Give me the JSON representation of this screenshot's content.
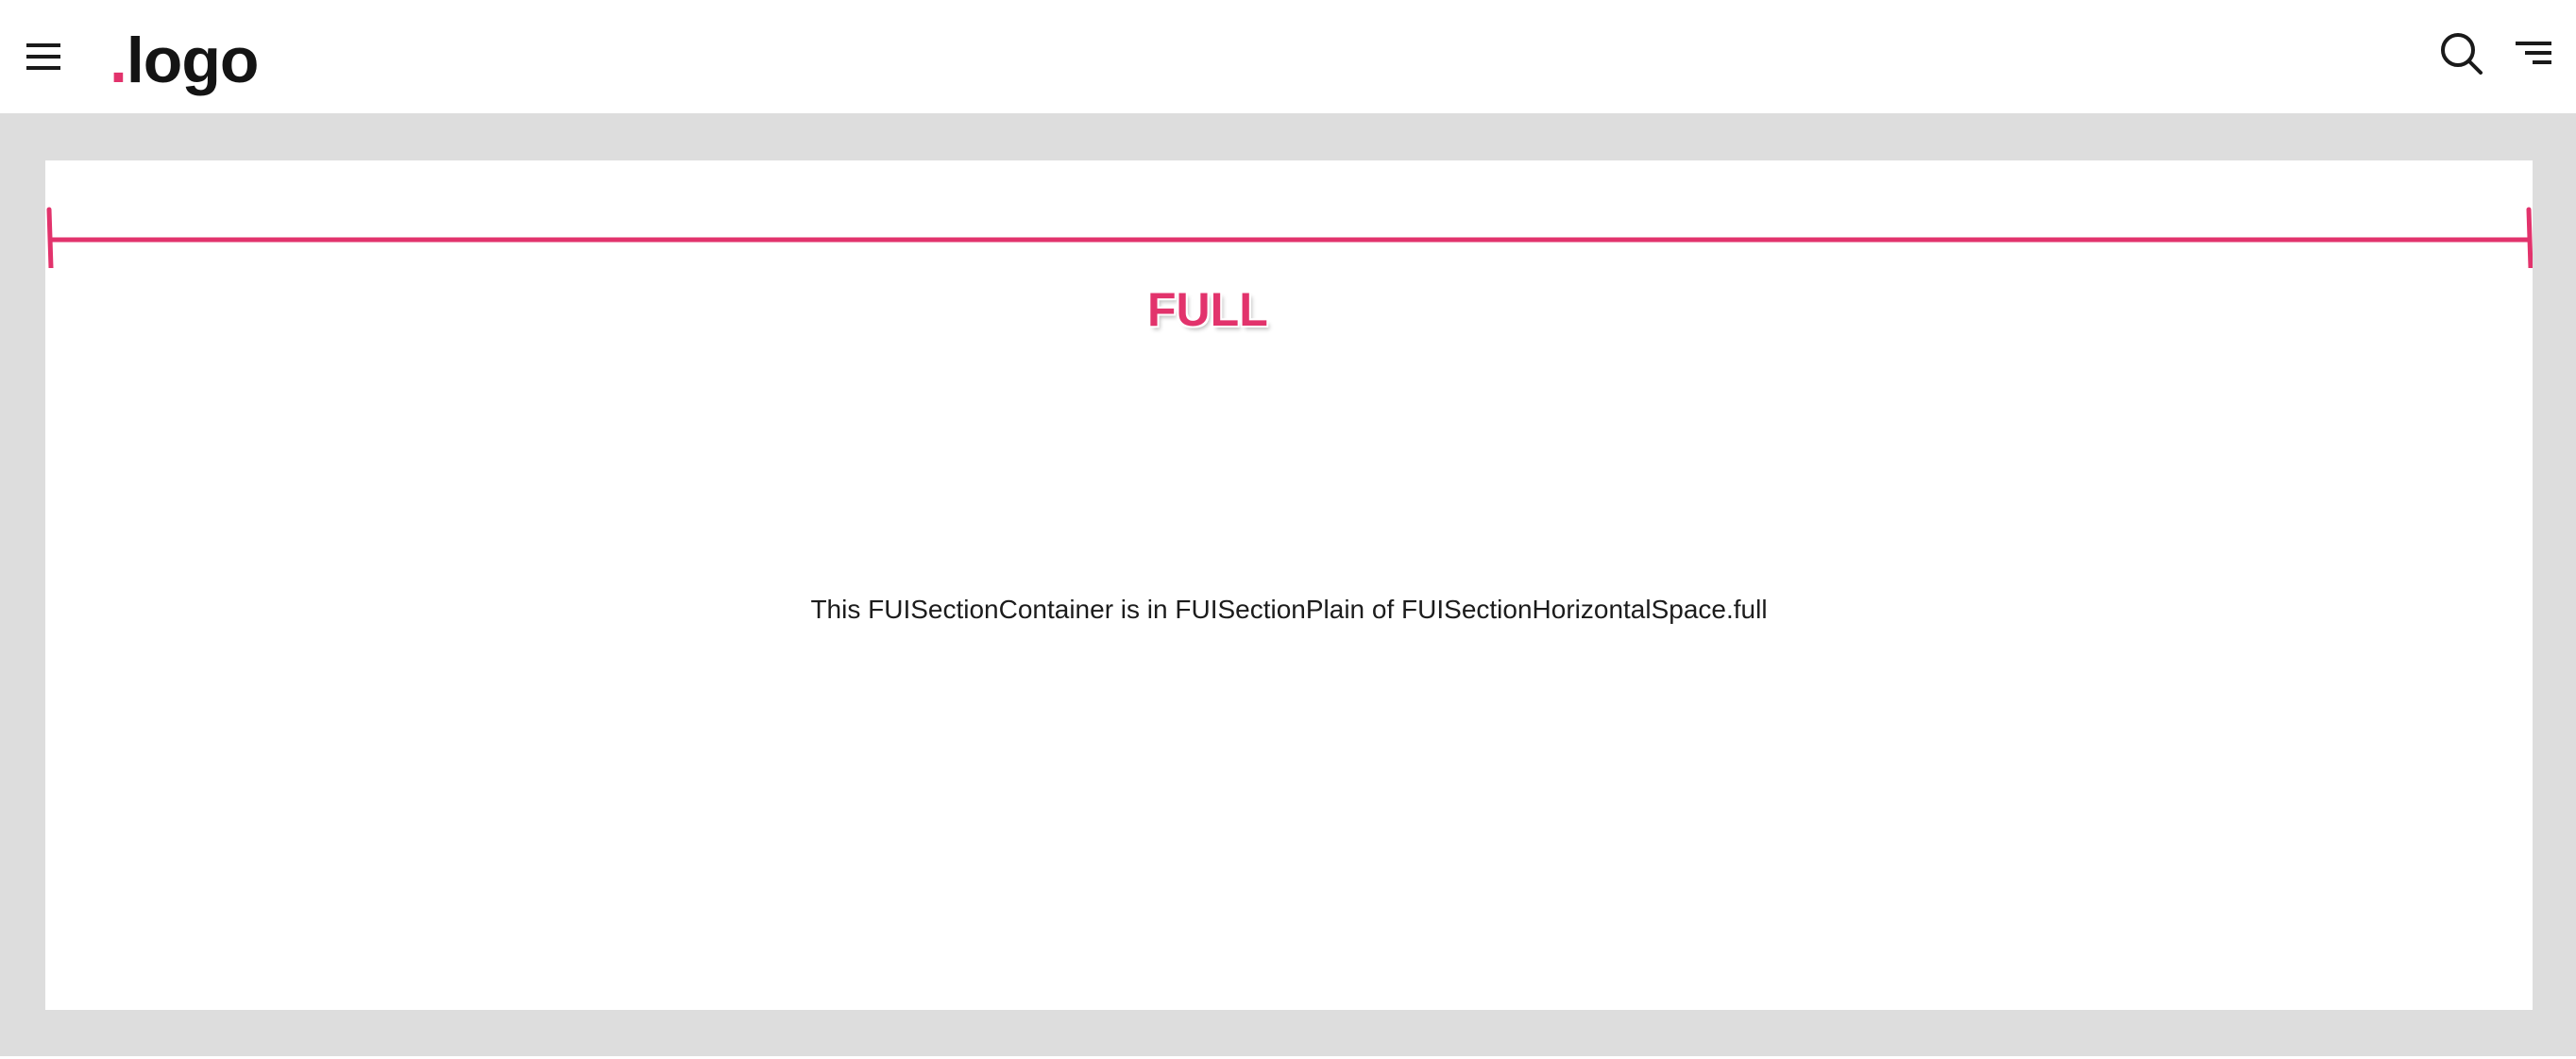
{
  "header": {
    "menu_icon": "hamburger-menu-icon",
    "logo": {
      "dot": ".",
      "text": "logo",
      "dot_color": "#e2336c"
    },
    "search_icon": "search-icon",
    "filter_icon": "filter-sort-icon"
  },
  "section": {
    "span_label": "FULL",
    "span_color": "#e2336c",
    "description": "This FUISectionContainer is in FUISectionPlain of FUISectionHorizontalSpace.full"
  },
  "colors": {
    "page_background": "#dddddd",
    "surface": "#ffffff",
    "accent": "#e2336c",
    "text": "#1c1c1c"
  }
}
